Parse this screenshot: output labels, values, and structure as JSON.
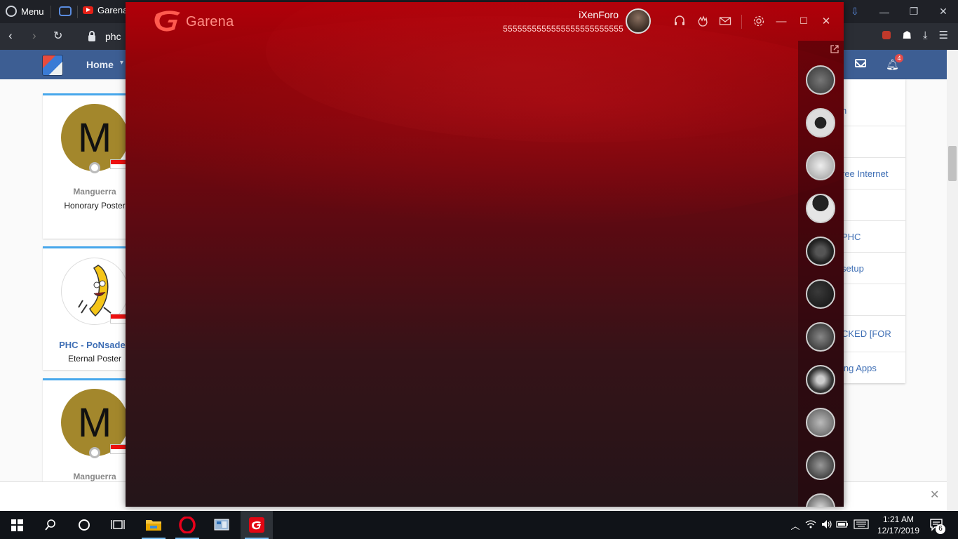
{
  "browser": {
    "menu_label": "Menu",
    "tab_title": "Garena",
    "address_text": "phc",
    "notification_count": "4"
  },
  "forum": {
    "nav_home": "Home",
    "members": [
      {
        "initial": "M",
        "name": "Manguerra",
        "title": "Honorary Poster"
      },
      {
        "name": "PHC - PoNsades",
        "title": "Eternal Poster"
      },
      {
        "initial": "M",
        "name": "Manguerra"
      }
    ],
    "side_items": [
      "n",
      "",
      "ree Internet",
      "",
      "PHC",
      "setup",
      "",
      "CKED [FOR",
      "ing Apps"
    ]
  },
  "garena": {
    "brand": "Garena",
    "username": "iXenForo",
    "status": "5555555555555555555555555",
    "friends_count": 11
  },
  "taskbar": {
    "time": "1:21 AM",
    "date": "12/17/2019",
    "action_center_count": "6"
  },
  "colors": {
    "garena_red": "#b10009",
    "forum_nav": "#3d5e93",
    "taskbar": "#101318"
  }
}
